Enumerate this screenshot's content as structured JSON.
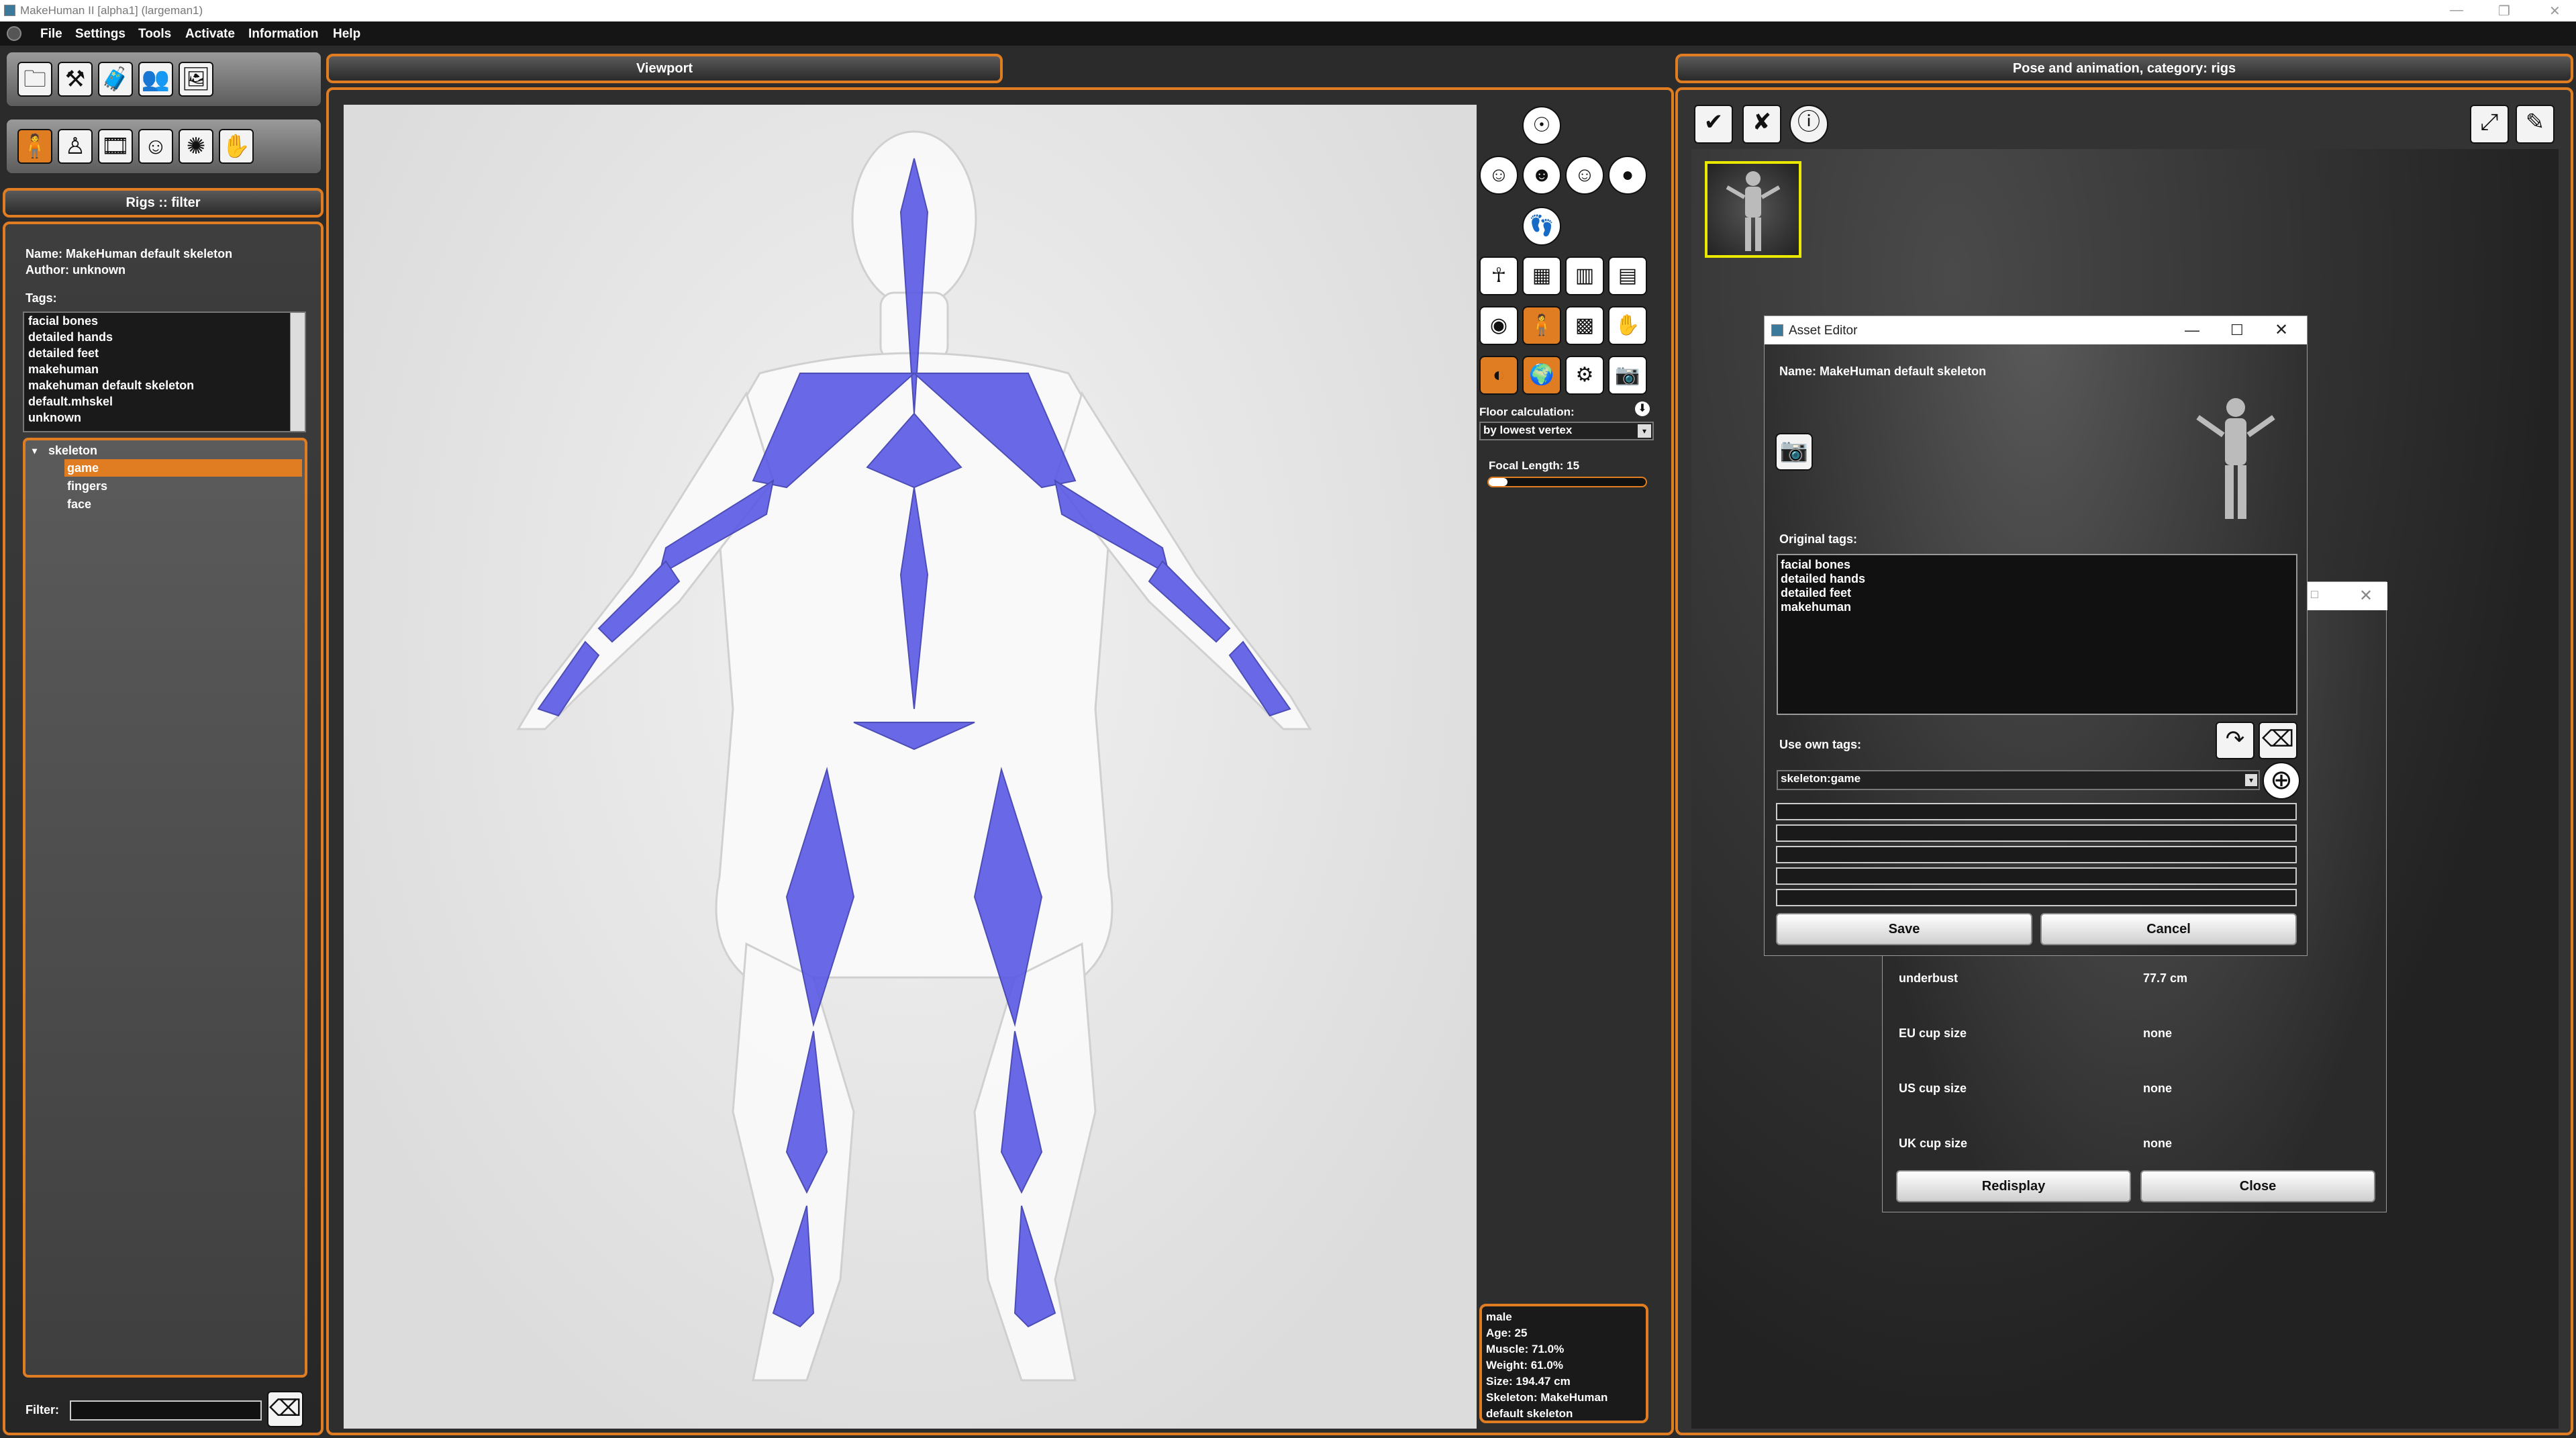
{
  "window": {
    "title": "MakeHuman II [alpha1]  (largeman1)",
    "controls": [
      "—",
      "❐",
      "✕"
    ]
  },
  "menu": [
    "File",
    "Settings",
    "Tools",
    "Activate",
    "Information",
    "Help"
  ],
  "toolbar_top": [
    {
      "icon": "folder-icon",
      "glyph": "🗀"
    },
    {
      "icon": "tools-icon",
      "glyph": "⚒"
    },
    {
      "icon": "luggage-icon",
      "glyph": "🧳"
    },
    {
      "icon": "people-icon",
      "glyph": "👥"
    },
    {
      "icon": "image-icon",
      "glyph": "🖼"
    }
  ],
  "toolbar_second": [
    {
      "icon": "body-icon",
      "glyph": "🧍",
      "selected": true
    },
    {
      "icon": "figure-icon",
      "glyph": "♙"
    },
    {
      "icon": "film-icon",
      "glyph": "🎞"
    },
    {
      "icon": "mask-icon",
      "glyph": "☺"
    },
    {
      "icon": "brain-icon",
      "glyph": "✺"
    },
    {
      "icon": "pose-icon",
      "glyph": "✋"
    }
  ],
  "left": {
    "header": "Rigs :: filter",
    "name_line": "Name: MakeHuman default skeleton",
    "author_line": "Author: unknown",
    "tags_label": "Tags:",
    "tags": [
      "facial bones",
      "detailed hands",
      "detailed feet",
      "makehuman",
      "makehuman default skeleton",
      "default.mhskel",
      "unknown"
    ],
    "tree_root": "skeleton",
    "tree_children": [
      "game",
      "fingers",
      "face"
    ],
    "tree_selected": "game",
    "filter_label": "Filter:",
    "filter_value": ""
  },
  "viewport": {
    "header": "Viewport",
    "tools": {
      "floor_label": "Floor calculation:",
      "floor_value": "by lowest vertex",
      "focal_label": "Focal Length: 15",
      "focal_fraction": 0.12
    },
    "info": [
      "male",
      "Age: 25",
      "Muscle: 71.0%",
      "Weight: 61.0%",
      "Size: 194.47 cm",
      "Skeleton: MakeHuman",
      "default skeleton"
    ]
  },
  "right": {
    "header": "Pose and animation, category: rigs"
  },
  "asset_editor": {
    "title": "Asset Editor",
    "name_line": "Name: MakeHuman default skeleton",
    "original_tags_label": "Original tags:",
    "original_tags": [
      "facial bones",
      "detailed hands",
      "detailed feet",
      "makehuman"
    ],
    "use_own_tags_label": "Use own tags:",
    "tag_combo_value": "skeleton:game",
    "save_label": "Save",
    "cancel_label": "Cancel"
  },
  "measure_dialog": {
    "rows": [
      {
        "label": "underbust",
        "value": "77.7 cm"
      },
      {
        "label": "EU cup size",
        "value": "none"
      },
      {
        "label": "US cup size",
        "value": "none"
      },
      {
        "label": "UK cup size",
        "value": "none"
      }
    ],
    "redisplay_label": "Redisplay",
    "close_label": "Close"
  }
}
